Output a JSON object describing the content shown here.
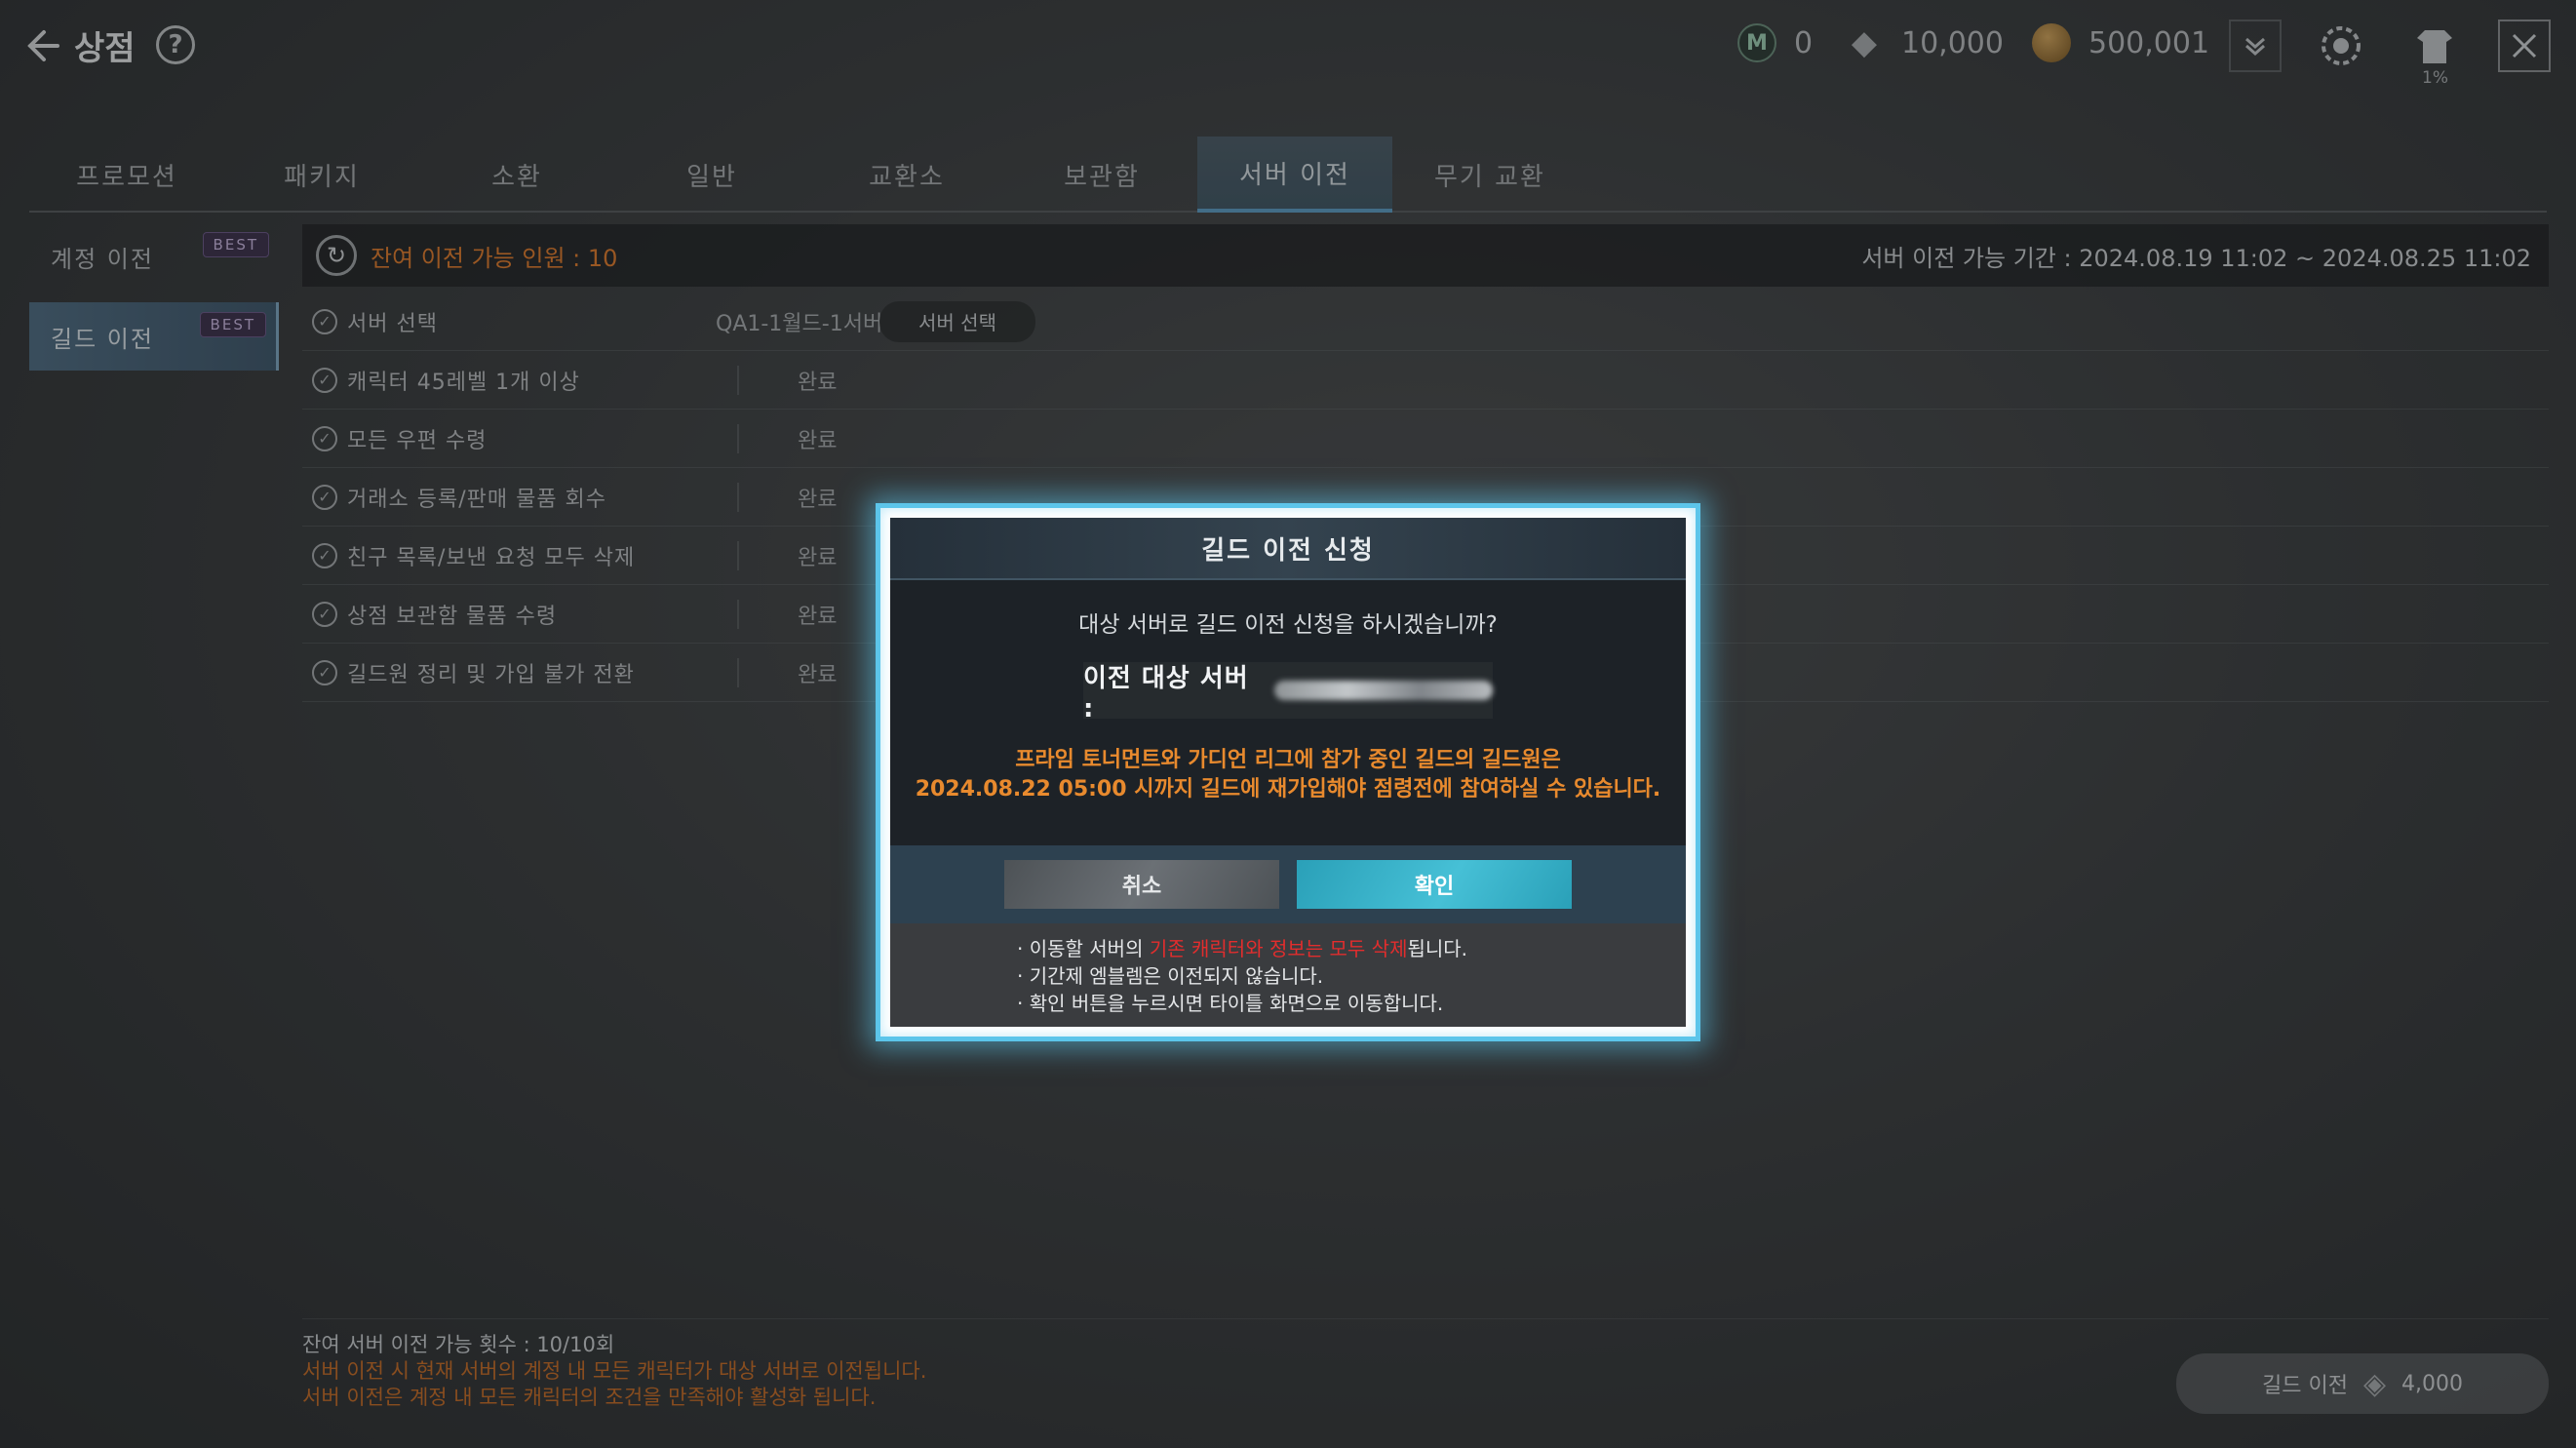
{
  "header": {
    "title": "상점",
    "currency": [
      {
        "icon": "m-coin-icon",
        "value": "0"
      },
      {
        "icon": "diamond-icon",
        "value": "10,000"
      },
      {
        "icon": "gold-coin-icon",
        "value": "500,001"
      }
    ],
    "costume_percent": "1%"
  },
  "tabs": [
    {
      "label": "프로모션"
    },
    {
      "label": "패키지"
    },
    {
      "label": "소환"
    },
    {
      "label": "일반"
    },
    {
      "label": "교환소"
    },
    {
      "label": "보관함"
    },
    {
      "label": "서버 이전",
      "active": true
    },
    {
      "label": "무기 교환"
    }
  ],
  "sidebar": {
    "items": [
      {
        "label": "계정 이전",
        "badge": "BEST"
      },
      {
        "label": "길드 이전",
        "badge": "BEST",
        "active": true
      }
    ]
  },
  "status": {
    "remaining": "잔여 이전 가능 인원 : 10",
    "period": "서버 이전 가능 기간 : 2024.08.19 11:02 ~ 2024.08.25 11:02"
  },
  "requirements": {
    "server": {
      "label": "서버 선택",
      "value": "QA1-1월드-1서버",
      "button": "서버 선택"
    },
    "items": [
      {
        "label": "캐릭터 45레벨 1개 이상",
        "value": "완료"
      },
      {
        "label": "모든 우편 수령",
        "value": "완료"
      },
      {
        "label": "거래소 등록/판매 물품 회수",
        "value": "완료"
      },
      {
        "label": "친구 목록/보낸 요청 모두 삭제",
        "value": "완료"
      },
      {
        "label": "상점 보관함 물품 수령",
        "value": "완료"
      },
      {
        "label": "길드원 정리 및 가입 불가 전환",
        "value": "완료"
      }
    ]
  },
  "footer": {
    "count": "잔여 서버 이전 가능 횟수 : 10/10회",
    "warn1": "서버 이전 시 현재 서버의 계정 내 모든 캐릭터가 대상 서버로 이전됩니다.",
    "warn2": "서버 이전은 계정 내 모든 캐릭터의 조건을 만족해야 활성화 됩니다.",
    "guild_button": "길드 이전",
    "guild_price": "4,000"
  },
  "modal": {
    "title": "길드 이전 신청",
    "question": "대상 서버로 길드 이전 신청을 하시겠습니까?",
    "target_label": "이전 대상 서버 :",
    "warn_line1": "프라임 토너먼트와 가디언 리그에 참가 중인 길드의 길드원은",
    "warn_line2": "2024.08.22 05:00 시까지 길드에 재가입해야 점령전에 참여하실 수 있습니다.",
    "cancel": "취소",
    "confirm": "확인",
    "note1_pre": "· 이동할 서버의 ",
    "note1_red": "기존 캐릭터와 정보는 모두 삭제",
    "note1_post": "됩니다.",
    "note2": "· 기간제 엠블렘은 이전되지 않습니다.",
    "note3": "· 확인 버튼을 누르시면 타이틀 화면으로 이동합니다."
  }
}
